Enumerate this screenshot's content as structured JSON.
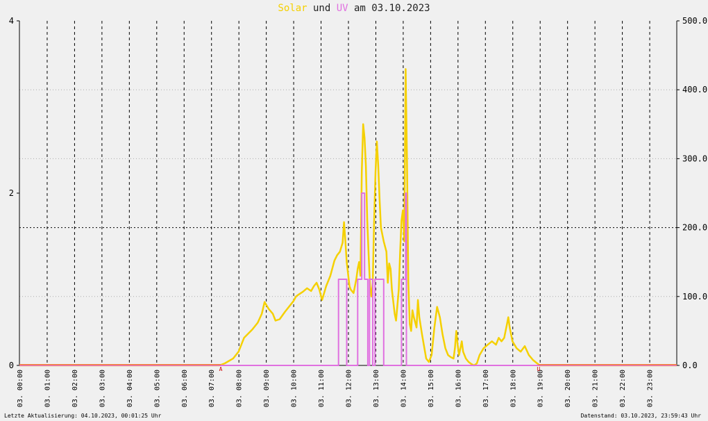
{
  "title": {
    "part1": "Solar",
    "part2": " und ",
    "part3": "UV",
    "part4": " am 03.10.2023"
  },
  "footer": {
    "left": "Letzte Aktualisierung: 04.10.2023, 00:01:25 Uhr",
    "right": "Datenstand: 03.10.2023, 23:59:43 Uhr"
  },
  "colors": {
    "solar": "#f5d000",
    "uv": "#e070e0",
    "baseline": "#f08050",
    "grid": "#000000",
    "background": "#f0f0f0"
  },
  "chart_data": {
    "type": "line",
    "x_range_hours": [
      0,
      24
    ],
    "x_tick_labels": [
      "03. 00:00",
      "03. 01:00",
      "03. 02:00",
      "03. 03:00",
      "03. 04:00",
      "03. 05:00",
      "03. 06:00",
      "03. 07:00",
      "03. 08:00",
      "03. 09:00",
      "03. 10:00",
      "03. 11:00",
      "03. 12:00",
      "03. 13:00",
      "03. 14:00",
      "03. 15:00",
      "03. 16:00",
      "03. 17:00",
      "03. 18:00",
      "03. 19:00",
      "03. 20:00",
      "03. 21:00",
      "03. 22:00",
      "03. 23:00"
    ],
    "y_left": {
      "range": [
        0,
        4
      ],
      "ticks": [
        "0",
        "2",
        "4"
      ]
    },
    "y_right": {
      "range": [
        0,
        500
      ],
      "ticks": [
        "0.0",
        "100.0",
        "200.0",
        "300.0",
        "400.0",
        "500.0"
      ]
    },
    "markers": [
      {
        "label": "A",
        "x_hour": 7.35
      },
      {
        "label": "U",
        "x_hour": 18.95
      }
    ],
    "series": [
      {
        "name": "Solar",
        "axis": "right",
        "points": [
          [
            0,
            0
          ],
          [
            7.3,
            0
          ],
          [
            7.5,
            3
          ],
          [
            7.8,
            10
          ],
          [
            8.0,
            20
          ],
          [
            8.2,
            40
          ],
          [
            8.5,
            52
          ],
          [
            8.7,
            62
          ],
          [
            8.85,
            75
          ],
          [
            8.95,
            92
          ],
          [
            9.1,
            82
          ],
          [
            9.25,
            75
          ],
          [
            9.35,
            65
          ],
          [
            9.5,
            67
          ],
          [
            9.7,
            78
          ],
          [
            9.9,
            88
          ],
          [
            10.0,
            93
          ],
          [
            10.1,
            100
          ],
          [
            10.2,
            103
          ],
          [
            10.35,
            107
          ],
          [
            10.5,
            112
          ],
          [
            10.65,
            108
          ],
          [
            10.75,
            115
          ],
          [
            10.85,
            120
          ],
          [
            10.95,
            110
          ],
          [
            11.05,
            95
          ],
          [
            11.2,
            115
          ],
          [
            11.35,
            130
          ],
          [
            11.5,
            152
          ],
          [
            11.6,
            160
          ],
          [
            11.7,
            165
          ],
          [
            11.8,
            178
          ],
          [
            11.85,
            208
          ],
          [
            11.9,
            180
          ],
          [
            11.95,
            150
          ],
          [
            12.05,
            115
          ],
          [
            12.1,
            110
          ],
          [
            12.2,
            105
          ],
          [
            12.3,
            125
          ],
          [
            12.35,
            140
          ],
          [
            12.4,
            150
          ],
          [
            12.45,
            130
          ],
          [
            12.5,
            280
          ],
          [
            12.55,
            350
          ],
          [
            12.6,
            330
          ],
          [
            12.65,
            290
          ],
          [
            12.7,
            210
          ],
          [
            12.75,
            160
          ],
          [
            12.8,
            115
          ],
          [
            12.85,
            100
          ],
          [
            12.9,
            120
          ],
          [
            12.95,
            210
          ],
          [
            13.0,
            280
          ],
          [
            13.05,
            325
          ],
          [
            13.1,
            290
          ],
          [
            13.15,
            240
          ],
          [
            13.2,
            200
          ],
          [
            13.3,
            180
          ],
          [
            13.4,
            165
          ],
          [
            13.45,
            120
          ],
          [
            13.5,
            148
          ],
          [
            13.55,
            140
          ],
          [
            13.6,
            110
          ],
          [
            13.7,
            75
          ],
          [
            13.75,
            65
          ],
          [
            13.85,
            110
          ],
          [
            13.9,
            165
          ],
          [
            13.95,
            210
          ],
          [
            14.0,
            225
          ],
          [
            14.05,
            180
          ],
          [
            14.1,
            430
          ],
          [
            14.15,
            300
          ],
          [
            14.2,
            120
          ],
          [
            14.25,
            60
          ],
          [
            14.3,
            50
          ],
          [
            14.35,
            80
          ],
          [
            14.4,
            70
          ],
          [
            14.5,
            55
          ],
          [
            14.55,
            95
          ],
          [
            14.6,
            70
          ],
          [
            14.7,
            45
          ],
          [
            14.85,
            10
          ],
          [
            14.95,
            5
          ],
          [
            15.05,
            15
          ],
          [
            15.15,
            55
          ],
          [
            15.25,
            85
          ],
          [
            15.35,
            70
          ],
          [
            15.45,
            45
          ],
          [
            15.55,
            25
          ],
          [
            15.65,
            15
          ],
          [
            15.75,
            12
          ],
          [
            15.85,
            10
          ],
          [
            15.9,
            25
          ],
          [
            15.95,
            50
          ],
          [
            16.0,
            30
          ],
          [
            16.05,
            15
          ],
          [
            16.1,
            25
          ],
          [
            16.15,
            35
          ],
          [
            16.2,
            20
          ],
          [
            16.3,
            10
          ],
          [
            16.4,
            5
          ],
          [
            16.5,
            2
          ],
          [
            16.6,
            0
          ],
          [
            16.7,
            3
          ],
          [
            16.8,
            15
          ],
          [
            16.95,
            25
          ],
          [
            17.1,
            30
          ],
          [
            17.25,
            35
          ],
          [
            17.4,
            30
          ],
          [
            17.5,
            40
          ],
          [
            17.6,
            35
          ],
          [
            17.7,
            40
          ],
          [
            17.8,
            60
          ],
          [
            17.85,
            70
          ],
          [
            17.9,
            55
          ],
          [
            18.0,
            35
          ],
          [
            18.15,
            25
          ],
          [
            18.3,
            20
          ],
          [
            18.45,
            28
          ],
          [
            18.6,
            15
          ],
          [
            18.75,
            8
          ],
          [
            18.9,
            3
          ],
          [
            19.0,
            0
          ],
          [
            24,
            0
          ]
        ]
      },
      {
        "name": "UV",
        "axis": "left",
        "points": [
          [
            0,
            0
          ],
          [
            11.65,
            0
          ],
          [
            11.65,
            1
          ],
          [
            11.95,
            1
          ],
          [
            11.95,
            0
          ],
          [
            12.35,
            0
          ],
          [
            12.35,
            1
          ],
          [
            12.5,
            1
          ],
          [
            12.5,
            2
          ],
          [
            12.6,
            2
          ],
          [
            12.6,
            1
          ],
          [
            12.72,
            1
          ],
          [
            12.72,
            0
          ],
          [
            12.78,
            0
          ],
          [
            12.78,
            1
          ],
          [
            12.9,
            1
          ],
          [
            12.9,
            0
          ],
          [
            12.98,
            0
          ],
          [
            12.98,
            1
          ],
          [
            13.3,
            1
          ],
          [
            13.3,
            0
          ],
          [
            13.95,
            0
          ],
          [
            13.95,
            1
          ],
          [
            14.1,
            1
          ],
          [
            14.1,
            2
          ],
          [
            14.13,
            2
          ],
          [
            14.13,
            0
          ],
          [
            24,
            0
          ]
        ]
      }
    ]
  }
}
